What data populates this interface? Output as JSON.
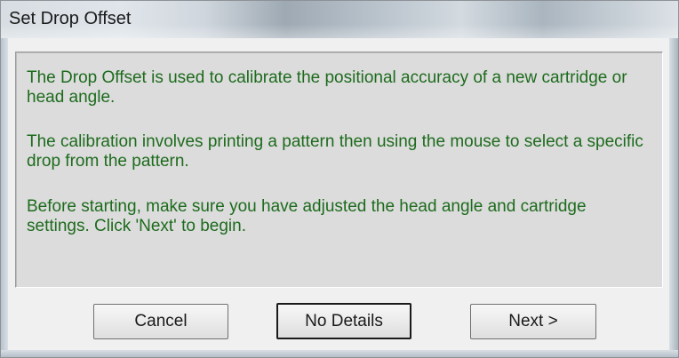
{
  "window": {
    "title": "Set Drop Offset"
  },
  "message": {
    "paragraph1": "The Drop Offset is used to calibrate the positional accuracy of a new cartridge or head angle.",
    "paragraph2": "The calibration involves printing a pattern then using the mouse to select a specific drop from the pattern.",
    "paragraph3": "Before starting, make sure you have adjusted the head angle and cartridge settings. Click 'Next' to begin.",
    "text_color": "#1d6b1d"
  },
  "buttons": {
    "cancel_label": "Cancel",
    "details_label": "No Details",
    "next_label": "Next >"
  }
}
